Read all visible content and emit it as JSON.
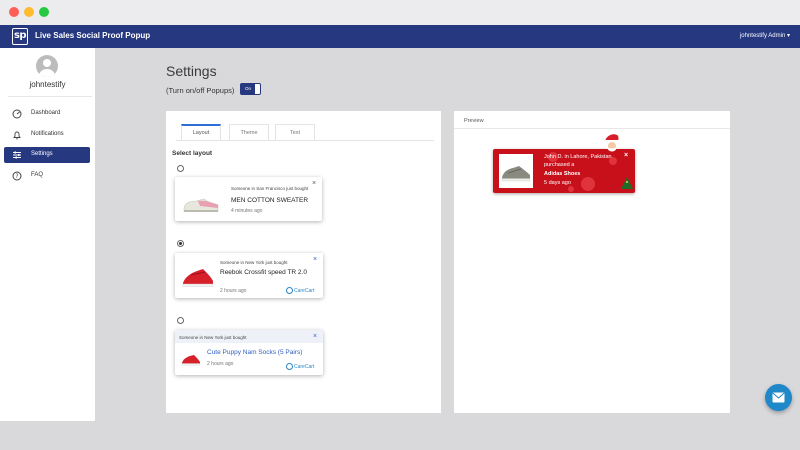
{
  "app": {
    "logo_text": "sp",
    "title": "Live Sales Social Proof Popup",
    "user_menu": "johntestify Admin ▾"
  },
  "sidebar": {
    "username": "johntestify",
    "items": [
      {
        "label": "Dashboard",
        "icon": "dashboard-icon"
      },
      {
        "label": "Notifications",
        "icon": "bell-icon"
      },
      {
        "label": "Settings",
        "icon": "sliders-icon",
        "active": true
      },
      {
        "label": "FAQ",
        "icon": "help-icon"
      }
    ]
  },
  "page": {
    "title": "Settings",
    "toggle_label": "(Turn on/off Popups)",
    "toggle_value": "On"
  },
  "layout_card": {
    "tabs": [
      "Layout",
      "Theme",
      "Text"
    ],
    "active_tab": "Layout",
    "select_label": "Select layout",
    "selected_option": 2,
    "options": [
      {
        "subtitle": "Someone in San Francisco just bought",
        "product": "MEN COTTON SWEATER",
        "time": "4 minutes ago"
      },
      {
        "subtitle": "Someone in New York just bought",
        "product": "Reebok Crossfit speed TR 2.0",
        "time": "2 hours ago",
        "brand": "CareCart"
      },
      {
        "subtitle": "Someone in New York just bought",
        "product": "Cute Puppy Nam Socks (5 Pairs)",
        "time": "2 hours ago",
        "brand": "CareCart"
      }
    ]
  },
  "preview_card": {
    "label": "Preview",
    "popup": {
      "line1": "John D. in Lahore, Pakistan",
      "line2": "purchased a",
      "product": "Adidas Shoes",
      "time": "5 days ago"
    }
  },
  "colors": {
    "brand_navy": "#263880",
    "preview_red": "#c8101a",
    "link_blue": "#2a86c6",
    "fab_blue": "#1e88c8"
  }
}
